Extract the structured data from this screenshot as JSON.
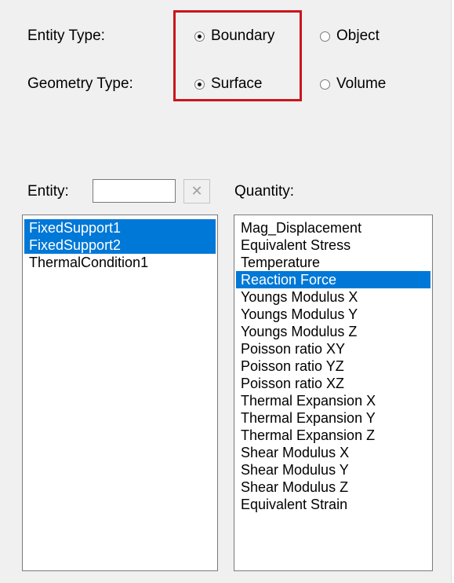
{
  "entity_type": {
    "label": "Entity Type:",
    "options": [
      "Boundary",
      "Object"
    ],
    "selected": "Boundary"
  },
  "geometry_type": {
    "label": "Geometry Type:",
    "options": [
      "Surface",
      "Volume"
    ],
    "selected": "Surface"
  },
  "entity_filter": {
    "label": "Entity:",
    "value": "",
    "clear_button": "✕"
  },
  "quantity": {
    "label": "Quantity:"
  },
  "entity_list": [
    {
      "label": "FixedSupport1",
      "selected": true
    },
    {
      "label": "FixedSupport2",
      "selected": true
    },
    {
      "label": "ThermalCondition1",
      "selected": false
    }
  ],
  "quantity_list": [
    {
      "label": "Mag_Displacement",
      "selected": false
    },
    {
      "label": "Equivalent Stress",
      "selected": false
    },
    {
      "label": "Temperature",
      "selected": false
    },
    {
      "label": "Reaction Force",
      "selected": true
    },
    {
      "label": "Youngs Modulus X",
      "selected": false
    },
    {
      "label": "Youngs Modulus Y",
      "selected": false
    },
    {
      "label": "Youngs Modulus Z",
      "selected": false
    },
    {
      "label": "Poisson ratio XY",
      "selected": false
    },
    {
      "label": "Poisson ratio YZ",
      "selected": false
    },
    {
      "label": "Poisson ratio XZ",
      "selected": false
    },
    {
      "label": "Thermal Expansion X",
      "selected": false
    },
    {
      "label": "Thermal Expansion Y",
      "selected": false
    },
    {
      "label": "Thermal Expansion Z",
      "selected": false
    },
    {
      "label": "Shear Modulus X",
      "selected": false
    },
    {
      "label": "Shear Modulus Y",
      "selected": false
    },
    {
      "label": "Shear Modulus Z",
      "selected": false
    },
    {
      "label": "Equivalent Strain",
      "selected": false
    }
  ],
  "colors": {
    "selection": "#0078d7",
    "highlight_border": "#c8161d",
    "background": "#f0f0f0"
  }
}
